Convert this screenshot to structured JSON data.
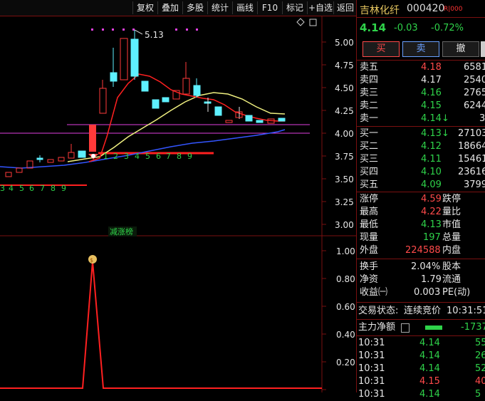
{
  "toolbar": {
    "items": [
      "复权",
      "叠加",
      "多股",
      "统计",
      "画线",
      "F10",
      "标记",
      "+自选",
      "返回"
    ]
  },
  "chart": {
    "price_axis": [
      "5.00",
      "4.75",
      "4.50",
      "4.25",
      "4.00",
      "3.75",
      "3.50",
      "3.25",
      "3.00"
    ],
    "indicator_axis": [
      "1.00",
      "0.80",
      "0.60",
      "0.40",
      "0.20",
      "0.00"
    ],
    "high_label": "5.13",
    "count_labels_a": [
      "3",
      "4",
      "5",
      "6",
      "7",
      "8",
      "9"
    ],
    "count_labels_b": [
      "1",
      "2",
      "3",
      "4",
      "5",
      "6",
      "7",
      "8",
      "9"
    ],
    "indicator_name": "减涨榜",
    "colors": {
      "up": "#ff3a3a",
      "down": "#5ef0ff",
      "ma_fast": "#ff2020",
      "ma_mid": "#f0f080",
      "ma_slow": "#3355ff",
      "magenta": "#e040e0"
    }
  },
  "quote": {
    "name": "吉林化纤",
    "code": "000420",
    "badge": "R|000",
    "price": "4.14",
    "change": "-0.03",
    "change_pct": "-0.72%",
    "buttons": [
      "买",
      "卖",
      "撤"
    ],
    "asks": [
      {
        "label": "卖五",
        "price": "4.18",
        "vol": "6581"
      },
      {
        "label": "卖四",
        "price": "4.17",
        "vol": "2540"
      },
      {
        "label": "卖三",
        "price": "4.16",
        "vol": "2765"
      },
      {
        "label": "卖二",
        "price": "4.15",
        "vol": "6244"
      },
      {
        "label": "卖一",
        "price": "4.14↓",
        "vol": "3"
      }
    ],
    "bids": [
      {
        "label": "买一",
        "price": "4.13↓",
        "vol": "27103"
      },
      {
        "label": "买二",
        "price": "4.12",
        "vol": "18664"
      },
      {
        "label": "买三",
        "price": "4.11",
        "vol": "15461"
      },
      {
        "label": "买四",
        "price": "4.10",
        "vol": "23616"
      },
      {
        "label": "买五",
        "price": "4.09",
        "vol": "3799"
      }
    ],
    "stats": [
      {
        "l1": "涨停",
        "v1": "4.59",
        "l2": "跌停"
      },
      {
        "l1": "最高",
        "v1": "4.22",
        "l2": "量比"
      },
      {
        "l1": "最低",
        "v1": "4.13",
        "l2": "市值"
      },
      {
        "l1": "现量",
        "v1": "197",
        "l2": "总量"
      },
      {
        "l1": "外盘",
        "v1": "224588",
        "l2": "内盘"
      }
    ],
    "stats2": [
      {
        "l1": "换手",
        "v1": "2.04%",
        "l2": "股本"
      },
      {
        "l1": "净资",
        "v1": "1.79",
        "l2": "流通"
      },
      {
        "l1": "收益㈠",
        "v1": "0.003",
        "l2": "PE(动)"
      }
    ],
    "status_label": "交易状态:",
    "status_value": "连续竞价",
    "status_time": "10:31:51",
    "net_label": "主力净额",
    "net_value": "-1737",
    "ticks": [
      {
        "t": "10:31",
        "p": "4.14",
        "v": "55"
      },
      {
        "t": "10:31",
        "p": "4.14",
        "v": "26"
      },
      {
        "t": "10:31",
        "p": "4.14",
        "v": "52"
      },
      {
        "t": "10:31",
        "p": "4.15",
        "v": "40"
      },
      {
        "t": "10:31",
        "p": "4.14",
        "v": "5"
      }
    ]
  }
}
